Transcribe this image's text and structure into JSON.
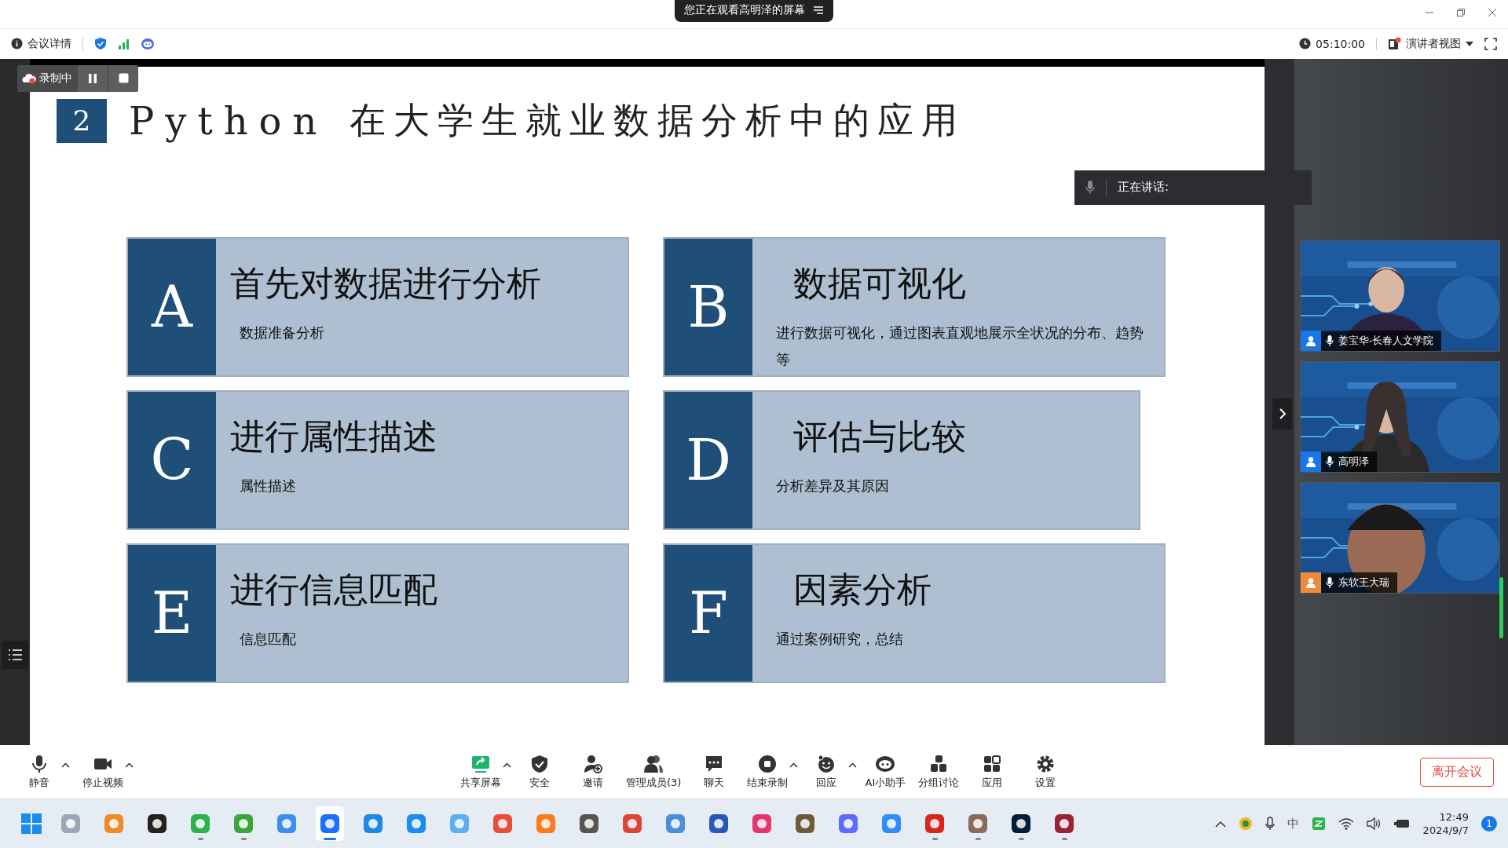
{
  "title_bar": {
    "banner": "您正在观看高明泽的屏幕"
  },
  "info_bar": {
    "meeting_details": "会议详情",
    "timer": "05:10:00",
    "view_mode": "演讲者视图"
  },
  "recording": {
    "label": "录制中"
  },
  "slide": {
    "number": "2",
    "title_latin": "Python",
    "title_cjk": "在大学生就业数据分析中的应用",
    "cards": [
      {
        "letter": "A",
        "heading": "首先对数据进行分析",
        "text": "数据准备分析"
      },
      {
        "letter": "B",
        "heading": "数据可视化",
        "text": "进行数据可视化，通过图表直观地展示全状况的分布、趋势等"
      },
      {
        "letter": "C",
        "heading": "进行属性描述",
        "text": "属性描述"
      },
      {
        "letter": "D",
        "heading": "评估与比较",
        "text": "分析差异及其原因"
      },
      {
        "letter": "E",
        "heading": "进行信息匹配",
        "text": "信息匹配"
      },
      {
        "letter": "F",
        "heading": "因素分析",
        "text": "通过案例研究，总结"
      }
    ]
  },
  "speaking": {
    "label": "正在讲话:"
  },
  "participants": [
    {
      "name": "姜宝华-长春人文学院",
      "color": "#1677e8",
      "kind": "picture"
    },
    {
      "name": "高明泽",
      "color": "#1677e8",
      "kind": "picture"
    },
    {
      "name": "东软王大瑞",
      "color": "#ee8a3c",
      "kind": "picture"
    }
  ],
  "toolbar": {
    "left": [
      {
        "label": "静音",
        "kind": "mic",
        "has_menu": true
      },
      {
        "label": "停止视频",
        "kind": "camera",
        "has_menu": true
      }
    ],
    "center": [
      {
        "label": "共享屏幕",
        "kind": "share",
        "has_menu": true
      },
      {
        "label": "安全",
        "kind": "shield",
        "has_menu": false
      },
      {
        "label": "邀请",
        "kind": "invite",
        "has_menu": false
      },
      {
        "label": "管理成员(3)",
        "kind": "members",
        "has_menu": false
      },
      {
        "label": "聊天",
        "kind": "chat",
        "has_menu": false
      },
      {
        "label": "结束录制",
        "kind": "record",
        "has_menu": true
      },
      {
        "label": "回应",
        "kind": "emoji",
        "has_menu": true
      },
      {
        "label": "AI小助手",
        "kind": "robot",
        "has_menu": false
      },
      {
        "label": "分组讨论",
        "kind": "groups",
        "has_menu": false
      },
      {
        "label": "应用",
        "kind": "apps",
        "has_menu": false
      },
      {
        "label": "设置",
        "kind": "gear",
        "has_menu": false
      }
    ],
    "leave": "离开会议"
  },
  "taskbar": {
    "apps": [
      {
        "running": false,
        "selected": false
      },
      {
        "running": false,
        "selected": false
      },
      {
        "running": false,
        "selected": false
      },
      {
        "running": true,
        "selected": false
      },
      {
        "running": true,
        "selected": false
      },
      {
        "running": false,
        "selected": false
      },
      {
        "running": true,
        "selected": true
      },
      {
        "running": false,
        "selected": false
      },
      {
        "running": false,
        "selected": false
      },
      {
        "running": false,
        "selected": false
      },
      {
        "running": false,
        "selected": false
      },
      {
        "running": false,
        "selected": false
      },
      {
        "running": false,
        "selected": false
      },
      {
        "running": false,
        "selected": false
      },
      {
        "running": false,
        "selected": false
      },
      {
        "running": false,
        "selected": false
      },
      {
        "running": false,
        "selected": false
      },
      {
        "running": false,
        "selected": false
      },
      {
        "running": false,
        "selected": false
      },
      {
        "running": false,
        "selected": false
      },
      {
        "running": true,
        "selected": false
      },
      {
        "running": true,
        "selected": false
      },
      {
        "running": true,
        "selected": false
      },
      {
        "running": true,
        "selected": false
      }
    ],
    "ime": "中",
    "time": "12:49",
    "date": "2024/9/7",
    "notifications": "1"
  }
}
